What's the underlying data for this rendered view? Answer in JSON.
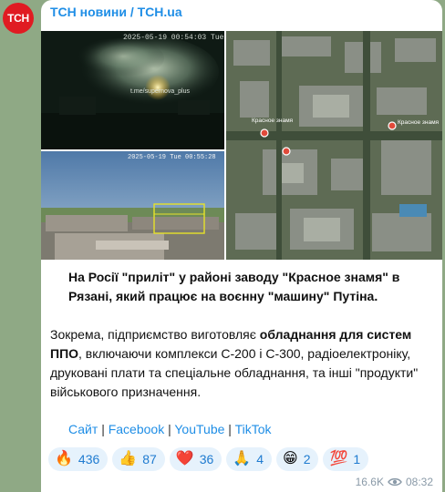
{
  "channel": {
    "name": "ТСН новини / TCH.ua",
    "avatar_text": "ТСН",
    "brand_color": "#e01b22",
    "accent_color": "#1f8ee6"
  },
  "photos": {
    "camera_timestamp": "2025-05-19 00:54:03 Tue",
    "camera_watermark": "t.me/supernova_plus",
    "camera_timestamp_2": "2025-05-19 Tue 00:55:28",
    "map_labels": [
      "Красное знамя",
      "Красное знамя"
    ]
  },
  "post": {
    "lead_part1": "На Росії \"приліт\" у районі заводу \"Красное знамя\" в Рязані, який працює на воєнну \"машину\" Путіна.",
    "body_part1": "Зокрема, підприємство виготовляє ",
    "body_bold": "обладнання для систем ППО",
    "body_part2": ", включаючи комплекси С-200 і С-300, радіоелектроніку, друковані плати та спеціальне обладнання, та інші \"продукти\" військового призначення."
  },
  "links": [
    {
      "label": "Сайт"
    },
    {
      "label": "Facebook"
    },
    {
      "label": "YouTube"
    },
    {
      "label": "TikTok"
    }
  ],
  "link_separator": "|",
  "reactions": [
    {
      "emoji": "🔥",
      "icon": "fire-icon",
      "count": "436"
    },
    {
      "emoji": "👍",
      "icon": "thumbs-up-icon",
      "count": "87"
    },
    {
      "emoji": "❤️",
      "icon": "heart-icon",
      "count": "36"
    },
    {
      "emoji": "🙏",
      "icon": "pray-icon",
      "count": "4"
    },
    {
      "emoji": "😁",
      "icon": "grin-icon",
      "count": "2"
    },
    {
      "emoji": "💯",
      "icon": "hundred-icon",
      "count": "1"
    }
  ],
  "meta": {
    "views": "16.6K",
    "time": "08:32"
  }
}
